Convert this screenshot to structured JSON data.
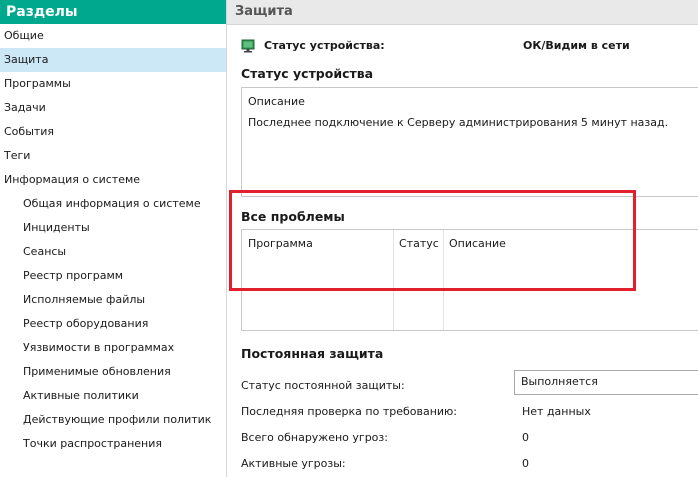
{
  "sidebar": {
    "title": "Разделы",
    "items": [
      {
        "label": "Общие"
      },
      {
        "label": "Защита"
      },
      {
        "label": "Программы"
      },
      {
        "label": "Задачи"
      },
      {
        "label": "События"
      },
      {
        "label": "Теги"
      },
      {
        "label": "Информация о системе"
      },
      {
        "label": "Общая информация о системе"
      },
      {
        "label": "Инциденты"
      },
      {
        "label": "Сеансы"
      },
      {
        "label": "Реестр программ"
      },
      {
        "label": "Исполняемые файлы"
      },
      {
        "label": "Реестр оборудования"
      },
      {
        "label": "Уязвимости в программах"
      },
      {
        "label": "Применимые обновления"
      },
      {
        "label": "Активные политики"
      },
      {
        "label": "Действующие профили политик"
      },
      {
        "label": "Точки распространения"
      }
    ]
  },
  "main": {
    "title": "Защита",
    "device_status": {
      "icon": "monitor-icon",
      "label": "Статус устройства:",
      "value": "ОК/Видим в сети"
    },
    "status_section": {
      "title": "Статус устройства",
      "description_header": "Описание",
      "description_text": "Последнее подключение к Серверу администрирования 5 минут назад."
    },
    "problems": {
      "title": "Все проблемы",
      "columns": [
        "Программа",
        "Статус",
        "Описание"
      ]
    },
    "realtime": {
      "title": "Постоянная защита",
      "status_label": "Статус постоянной защиты:",
      "status_value": "Выполняется",
      "last_scan_label": "Последняя проверка по требованию:",
      "last_scan_value": "Нет данных",
      "threats_total_label": "Всего обнаружено угроз:",
      "threats_total_value": "0",
      "active_threats_label": "Активные угрозы:",
      "active_threats_value": "0"
    }
  },
  "colors": {
    "sidebar_header": "#00a88e",
    "selected_item": "#cce8f7",
    "highlight": "#e0202c",
    "monitor_icon": "#2f8f4e"
  }
}
